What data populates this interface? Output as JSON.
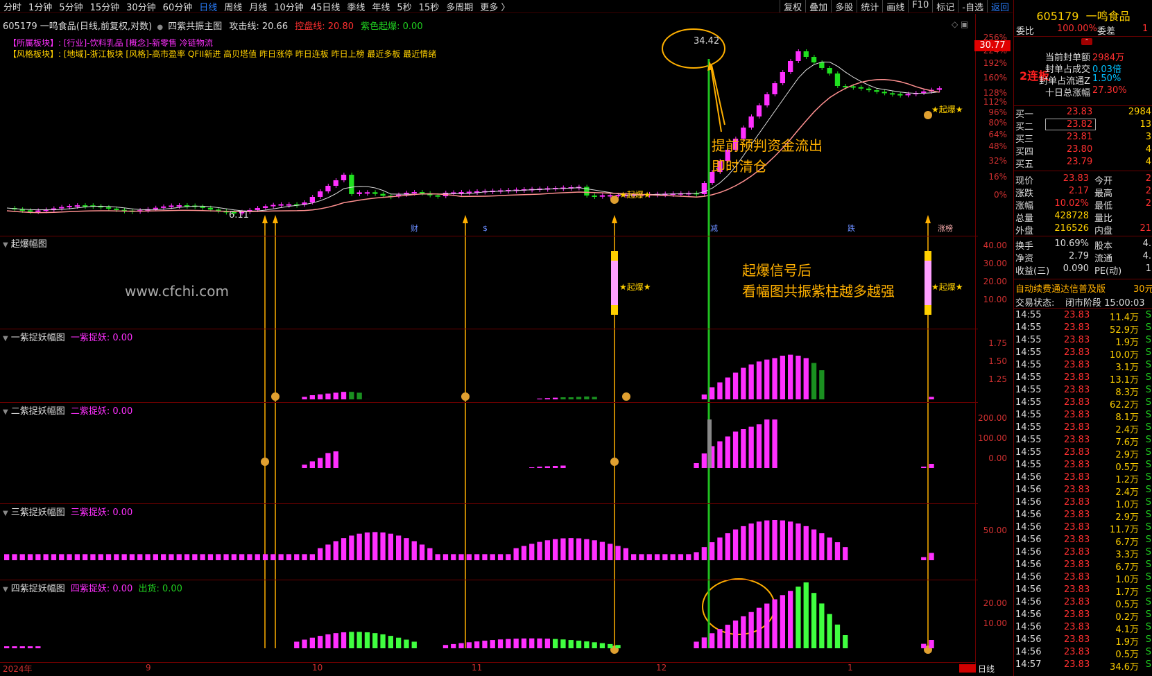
{
  "toolbar": {
    "periods": [
      "分时",
      "1分钟",
      "5分钟",
      "15分钟",
      "30分钟",
      "60分钟",
      "日线",
      "周线",
      "月线",
      "10分钟",
      "45日线",
      "季线",
      "年线",
      "5秒",
      "15秒",
      "多周期",
      "更多 〉"
    ],
    "active_period": "日线",
    "right_tools": [
      "复权",
      "叠加",
      "多股",
      "统计",
      "画线",
      "F10",
      "标记",
      "-自选",
      "返回"
    ]
  },
  "main_chart": {
    "title": "605179 一鸣食品(日线,前复权,对数)",
    "indicator_name": "四紫共振主图",
    "attack_line_label": "攻击线:",
    "attack_line_value": "20.66",
    "control_line_label": "控盘线:",
    "control_line_value": "20.80",
    "purple_signal_label": "紫色起爆:",
    "purple_signal_value": "0.00",
    "sector_label": "【所属板块】:",
    "sector_text": "[行业]-饮料乳品 [概念]-新零售 冷链物流",
    "style_label": "【风格板块】:",
    "style_text": "[地域]-浙江板块 [风格]-高市盈率 QFII新进 高贝塔值 昨日涨停 昨日连板 昨日上榜 最近多板 最近情绪",
    "high_label": "34.42",
    "low_label": "6.11",
    "last_price_tag": "30.77",
    "y_axis": [
      "256%",
      "224%",
      "192%",
      "160%",
      "128%",
      "112%",
      "96%",
      "80%",
      "64%",
      "48%",
      "32%",
      "16%",
      "0%"
    ],
    "signal_text": "★起爆★",
    "event_marks": [
      "财",
      "$",
      "减",
      "跌",
      "涨榜"
    ]
  },
  "panels": [
    {
      "name": "起爆幅图",
      "value_text": "",
      "y_axis": [
        "40.00",
        "30.00",
        "20.00",
        "10.00"
      ]
    },
    {
      "name": "一紫捉妖幅图",
      "value_text": "一紫捉妖: 0.00",
      "y_axis": [
        "1.75",
        "1.50",
        "1.25"
      ]
    },
    {
      "name": "二紫捉妖幅图",
      "value_text": "二紫捉妖: 0.00",
      "y_axis": [
        "200.00",
        "100.00",
        "0.00"
      ]
    },
    {
      "name": "三紫捉妖幅图",
      "value_text": "三紫捉妖: 0.00",
      "y_axis": [
        "50.00"
      ]
    },
    {
      "name": "四紫捉妖幅图",
      "value_text": "四紫捉妖: 0.00",
      "extra_text": "出货: 0.00",
      "y_axis": [
        "20.00",
        "10.00"
      ]
    }
  ],
  "watermark": "www.cfchi.com",
  "annotations": {
    "exit_line1": "提前预判资金流出",
    "exit_line2": "即时清仓",
    "tip_line1": "起爆信号后",
    "tip_line2": "看幅图共振紫柱越多越强"
  },
  "time_axis": [
    "2024年",
    "9",
    "10",
    "11",
    "12",
    "1"
  ],
  "time_axis_period": "日线",
  "right_panel": {
    "code": "605179",
    "name": "一鸣食品",
    "weibi_label": "委比",
    "weibi_value": "100.00%",
    "weicha_label": "委差",
    "weicha_value": "1",
    "streak_badge": "2连板",
    "seal_rows": [
      {
        "label": "当前封单额",
        "value": "2984万"
      },
      {
        "label": "封单占成交",
        "value": "0.03倍"
      },
      {
        "label": "封单占流通Z",
        "value": "1.50%"
      },
      {
        "label": "十日总涨幅",
        "value": "27.30%"
      }
    ],
    "bids": [
      {
        "label": "买一",
        "price": "23.83",
        "vol": "2984"
      },
      {
        "label": "买二",
        "price": "23.82",
        "vol": "13"
      },
      {
        "label": "买三",
        "price": "23.81",
        "vol": "3"
      },
      {
        "label": "买四",
        "price": "23.80",
        "vol": "4"
      },
      {
        "label": "买五",
        "price": "23.79",
        "vol": "4"
      }
    ],
    "quote_rows": [
      {
        "l1": "现价",
        "v1": "23.83",
        "l2": "今开",
        "v2": "2"
      },
      {
        "l1": "涨跌",
        "v1": "2.17",
        "l2": "最高",
        "v2": "2"
      },
      {
        "l1": "涨幅",
        "v1": "10.02%",
        "l2": "最低",
        "v2": "2"
      },
      {
        "l1": "总量",
        "v1": "428728",
        "l2": "量比",
        "v2": ""
      },
      {
        "l1": "外盘",
        "v1": "216526",
        "l2": "内盘",
        "v2": "21"
      }
    ],
    "stat_rows": [
      {
        "l1": "换手",
        "v1": "10.69%",
        "l2": "股本",
        "v2": "4."
      },
      {
        "l1": "净资",
        "v1": "2.79",
        "l2": "流通",
        "v2": "4."
      },
      {
        "l1": "收益(三)",
        "v1": "0.090",
        "l2": "PE(动)",
        "v2": "1"
      }
    ],
    "promo_text": "自动续费通达信普及版",
    "promo_price": "30元",
    "trade_status_label": "交易状态:",
    "trade_status_value": "闭市阶段 15:00:03",
    "ticks": [
      {
        "t": "14:55",
        "p": "23.83",
        "v": "11.4万",
        "f": "S"
      },
      {
        "t": "14:55",
        "p": "23.83",
        "v": "52.9万",
        "f": "S"
      },
      {
        "t": "14:55",
        "p": "23.83",
        "v": "1.9万",
        "f": "S"
      },
      {
        "t": "14:55",
        "p": "23.83",
        "v": "10.0万",
        "f": "S"
      },
      {
        "t": "14:55",
        "p": "23.83",
        "v": "3.1万",
        "f": "S"
      },
      {
        "t": "14:55",
        "p": "23.83",
        "v": "13.1万",
        "f": "S"
      },
      {
        "t": "14:55",
        "p": "23.83",
        "v": "8.3万",
        "f": "S"
      },
      {
        "t": "14:55",
        "p": "23.83",
        "v": "62.2万",
        "f": "S"
      },
      {
        "t": "14:55",
        "p": "23.83",
        "v": "8.1万",
        "f": "S"
      },
      {
        "t": "14:55",
        "p": "23.83",
        "v": "2.4万",
        "f": "S"
      },
      {
        "t": "14:55",
        "p": "23.83",
        "v": "7.6万",
        "f": "S"
      },
      {
        "t": "14:55",
        "p": "23.83",
        "v": "2.9万",
        "f": "S"
      },
      {
        "t": "14:55",
        "p": "23.83",
        "v": "0.5万",
        "f": "S"
      },
      {
        "t": "14:56",
        "p": "23.83",
        "v": "1.2万",
        "f": "S"
      },
      {
        "t": "14:56",
        "p": "23.83",
        "v": "2.4万",
        "f": "S"
      },
      {
        "t": "14:56",
        "p": "23.83",
        "v": "1.0万",
        "f": "S"
      },
      {
        "t": "14:56",
        "p": "23.83",
        "v": "2.9万",
        "f": "S"
      },
      {
        "t": "14:56",
        "p": "23.83",
        "v": "11.7万",
        "f": "S"
      },
      {
        "t": "14:56",
        "p": "23.83",
        "v": "6.7万",
        "f": "S"
      },
      {
        "t": "14:56",
        "p": "23.83",
        "v": "3.3万",
        "f": "S"
      },
      {
        "t": "14:56",
        "p": "23.83",
        "v": "6.7万",
        "f": "S"
      },
      {
        "t": "14:56",
        "p": "23.83",
        "v": "1.0万",
        "f": "S"
      },
      {
        "t": "14:56",
        "p": "23.83",
        "v": "1.7万",
        "f": "S"
      },
      {
        "t": "14:56",
        "p": "23.83",
        "v": "0.5万",
        "f": "S"
      },
      {
        "t": "14:56",
        "p": "23.83",
        "v": "0.2万",
        "f": "S"
      },
      {
        "t": "14:56",
        "p": "23.83",
        "v": "4.1万",
        "f": "S"
      },
      {
        "t": "14:56",
        "p": "23.83",
        "v": "1.9万",
        "f": "S"
      },
      {
        "t": "14:56",
        "p": "23.83",
        "v": "0.5万",
        "f": "S"
      },
      {
        "t": "14:57",
        "p": "23.83",
        "v": "34.6万",
        "f": "S"
      }
    ]
  },
  "colors": {
    "up": "#ff30ff",
    "down": "#20e020",
    "axis": "#d03030",
    "accent": "#ffb000"
  },
  "chart_data": {
    "type": "candlestick",
    "title": "",
    "ylabel": "",
    "y_scale": "percent (log)",
    "annotated_high": 34.42,
    "annotated_low": 6.11,
    "last_price": 30.77,
    "x_period_labels": [
      "2024年",
      "9",
      "10",
      "11",
      "12",
      "1"
    ]
  }
}
